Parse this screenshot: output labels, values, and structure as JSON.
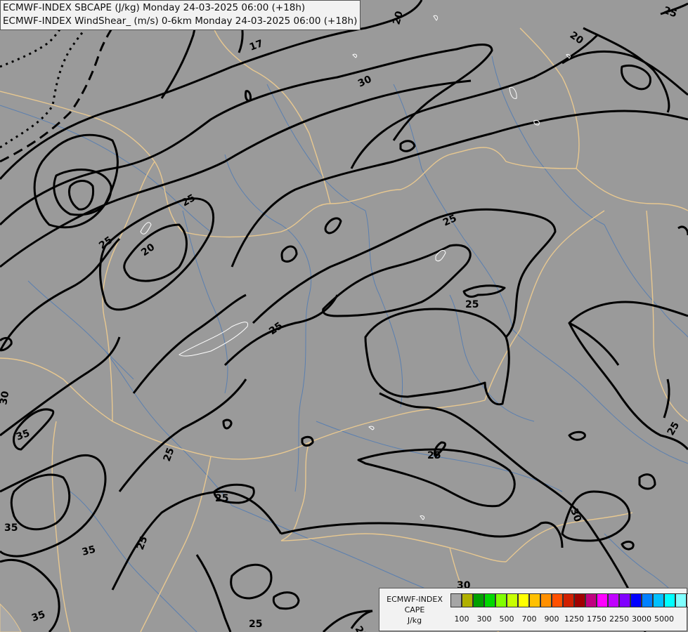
{
  "title": {
    "line1": "ECMWF-INDEX SBCAPE (J/kg) Monday 24-03-2025 06:00 (+18h)",
    "line2": "ECMWF-INDEX WindShear_ (m/s) 0-6km Monday 24-03-2025 06:00 (+18h)"
  },
  "legend": {
    "line1": "ECMWF-INDEX",
    "line2": "CAPE",
    "line3": "J/kg",
    "colors": [
      "#a6a6a6",
      "#b0b000",
      "#00a000",
      "#00d800",
      "#80ff00",
      "#c8ff00",
      "#ffff00",
      "#ffc000",
      "#ff9000",
      "#ff5000",
      "#d02000",
      "#a00000",
      "#c00080",
      "#ff00ff",
      "#c000ff",
      "#8000ff",
      "#0000ff",
      "#0080ff",
      "#00c0ff",
      "#00ffff",
      "#80ffff",
      "#ffffff"
    ],
    "ticks": [
      "100",
      "300",
      "500",
      "700",
      "900",
      "1250",
      "1750",
      "2250",
      "3000",
      "5000"
    ]
  },
  "contour_labels": {
    "l15": "15",
    "l17": "17",
    "l20a": "20",
    "l20b": "20",
    "l20c": "20",
    "l25a": "25",
    "l25b": "25",
    "l25c": "25",
    "l25d": "25",
    "l25e": "25",
    "l25f": "25",
    "l25g": "25",
    "l25h": "25",
    "l25i": "25",
    "l25j": "25",
    "l25k": "25",
    "l25l": "25",
    "l25m": "25",
    "l30a": "30",
    "l30b": "30",
    "l30c": "30",
    "l30d": "30",
    "l35a": "35",
    "l35b": "35",
    "l35c": "35",
    "l35d": "35"
  }
}
